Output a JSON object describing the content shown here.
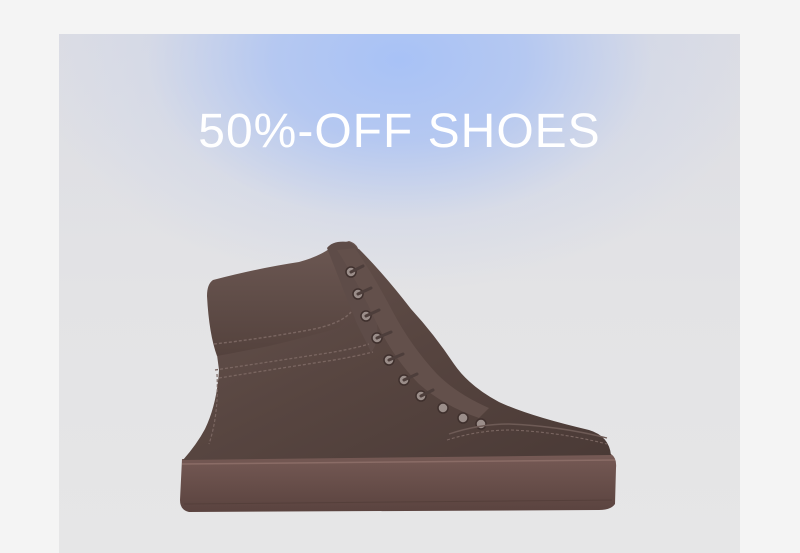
{
  "promo": {
    "headline": "50%-OFF SHOES",
    "product_image": "high-top-suede-sneaker",
    "colors": {
      "background": "#f4f4f4",
      "gradient_top": "#a8c2f6",
      "gradient_bottom": "#e6e6e7",
      "headline_text": "#ffffff",
      "shoe_suede": "#5b4a46",
      "shoe_sole": "#6a4f4a"
    }
  }
}
